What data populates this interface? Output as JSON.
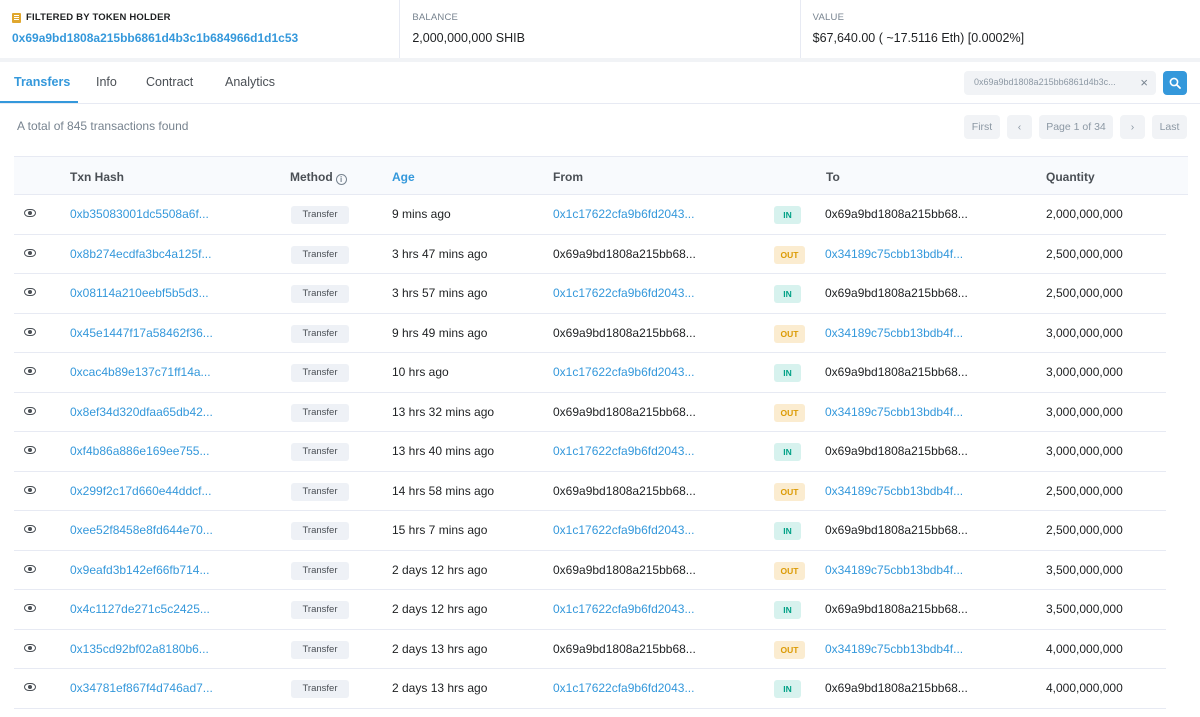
{
  "holder": {
    "label": "FILTERED BY TOKEN HOLDER",
    "address": "0x69a9bd1808a215bb6861d4b3c1b684966d1d1c53",
    "balance_label": "BALANCE",
    "balance": "2,000,000,000 SHIB",
    "value_label": "VALUE",
    "value": "$67,640.00 ( ~17.5116 Eth) [0.0002%]"
  },
  "tabs": [
    {
      "label": "Transfers",
      "active": true
    },
    {
      "label": "Info",
      "active": false
    },
    {
      "label": "Contract",
      "active": false
    },
    {
      "label": "Analytics",
      "active": false
    }
  ],
  "search": {
    "value": "0x69a9bd1808a215bb6861d4b3c...",
    "clear": "×"
  },
  "summary": "A total of 845 transactions found",
  "pager": {
    "first": "First",
    "prev": "‹",
    "page": "Page 1 of 34",
    "next": "›",
    "last": "Last"
  },
  "columns": {
    "hash": "Txn Hash",
    "method": "Method",
    "age": "Age",
    "from": "From",
    "to": "To",
    "quantity": "Quantity"
  },
  "rows": [
    {
      "hash": "0xb35083001dc5508a6f...",
      "method": "Transfer",
      "age": "9 mins ago",
      "from": "0x1c17622cfa9b6fd2043...",
      "dir": "IN",
      "to": "0x69a9bd1808a215bb68...",
      "qty": "2,000,000,000"
    },
    {
      "hash": "0x8b274ecdfa3bc4a125f...",
      "method": "Transfer",
      "age": "3 hrs 47 mins ago",
      "from": "0x69a9bd1808a215bb68...",
      "dir": "OUT",
      "to": "0x34189c75cbb13bdb4f...",
      "qty": "2,500,000,000"
    },
    {
      "hash": "0x08114a210eebf5b5d3...",
      "method": "Transfer",
      "age": "3 hrs 57 mins ago",
      "from": "0x1c17622cfa9b6fd2043...",
      "dir": "IN",
      "to": "0x69a9bd1808a215bb68...",
      "qty": "2,500,000,000"
    },
    {
      "hash": "0x45e1447f17a58462f36...",
      "method": "Transfer",
      "age": "9 hrs 49 mins ago",
      "from": "0x69a9bd1808a215bb68...",
      "dir": "OUT",
      "to": "0x34189c75cbb13bdb4f...",
      "qty": "3,000,000,000"
    },
    {
      "hash": "0xcac4b89e137c71ff14a...",
      "method": "Transfer",
      "age": "10 hrs ago",
      "from": "0x1c17622cfa9b6fd2043...",
      "dir": "IN",
      "to": "0x69a9bd1808a215bb68...",
      "qty": "3,000,000,000"
    },
    {
      "hash": "0x8ef34d320dfaa65db42...",
      "method": "Transfer",
      "age": "13 hrs 32 mins ago",
      "from": "0x69a9bd1808a215bb68...",
      "dir": "OUT",
      "to": "0x34189c75cbb13bdb4f...",
      "qty": "3,000,000,000"
    },
    {
      "hash": "0xf4b86a886e169ee755...",
      "method": "Transfer",
      "age": "13 hrs 40 mins ago",
      "from": "0x1c17622cfa9b6fd2043...",
      "dir": "IN",
      "to": "0x69a9bd1808a215bb68...",
      "qty": "3,000,000,000"
    },
    {
      "hash": "0x299f2c17d660e44ddcf...",
      "method": "Transfer",
      "age": "14 hrs 58 mins ago",
      "from": "0x69a9bd1808a215bb68...",
      "dir": "OUT",
      "to": "0x34189c75cbb13bdb4f...",
      "qty": "2,500,000,000"
    },
    {
      "hash": "0xee52f8458e8fd644e70...",
      "method": "Transfer",
      "age": "15 hrs 7 mins ago",
      "from": "0x1c17622cfa9b6fd2043...",
      "dir": "IN",
      "to": "0x69a9bd1808a215bb68...",
      "qty": "2,500,000,000"
    },
    {
      "hash": "0x9eafd3b142ef66fb714...",
      "method": "Transfer",
      "age": "2 days 12 hrs ago",
      "from": "0x69a9bd1808a215bb68...",
      "dir": "OUT",
      "to": "0x34189c75cbb13bdb4f...",
      "qty": "3,500,000,000"
    },
    {
      "hash": "0x4c1127de271c5c2425...",
      "method": "Transfer",
      "age": "2 days 12 hrs ago",
      "from": "0x1c17622cfa9b6fd2043...",
      "dir": "IN",
      "to": "0x69a9bd1808a215bb68...",
      "qty": "3,500,000,000"
    },
    {
      "hash": "0x135cd92bf02a8180b6...",
      "method": "Transfer",
      "age": "2 days 13 hrs ago",
      "from": "0x69a9bd1808a215bb68...",
      "dir": "OUT",
      "to": "0x34189c75cbb13bdb4f...",
      "qty": "4,000,000,000"
    },
    {
      "hash": "0x34781ef867f4d746ad7...",
      "method": "Transfer",
      "age": "2 days 13 hrs ago",
      "from": "0x1c17622cfa9b6fd2043...",
      "dir": "IN",
      "to": "0x69a9bd1808a215bb68...",
      "qty": "4,000,000,000"
    }
  ]
}
